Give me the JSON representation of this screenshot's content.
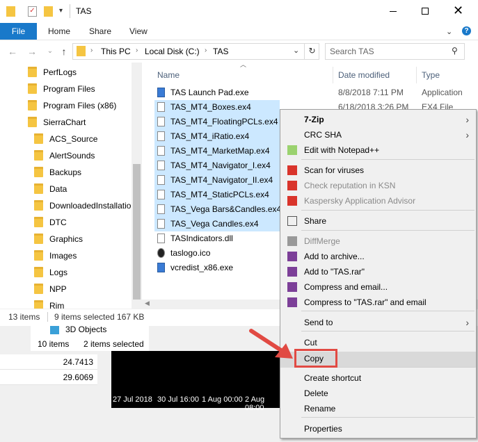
{
  "window": {
    "title": "TAS",
    "ribbon_tabs": [
      "File",
      "Home",
      "Share",
      "View"
    ]
  },
  "address": {
    "crumbs": [
      "This PC",
      "Local Disk (C:)",
      "TAS"
    ],
    "search_placeholder": "Search TAS"
  },
  "nav": {
    "items": [
      "PerfLogs",
      "Program Files",
      "Program Files (x86)",
      "SierraChart"
    ],
    "subitems": [
      "ACS_Source",
      "AlertSounds",
      "Backups",
      "Data",
      "DownloadedInstallatio",
      "DTC",
      "Graphics",
      "Images",
      "Logs",
      "NPP",
      "Rim"
    ]
  },
  "columns": {
    "name": "Name",
    "date": "Date modified",
    "type": "Type"
  },
  "files": [
    {
      "name": "TAS Launch Pad.exe",
      "date": "8/8/2018 7:11 PM",
      "type": "Application",
      "selected": false,
      "icon": "exe-icon"
    },
    {
      "name": "TAS_MT4_Boxes.ex4",
      "date": "6/18/2018 3:26 PM",
      "type": "EX4 File",
      "selected": true,
      "icon": "file-icon"
    },
    {
      "name": "TAS_MT4_FloatingPCLs.ex4",
      "date": "",
      "type": "",
      "selected": true,
      "icon": "file-icon"
    },
    {
      "name": "TAS_MT4_iRatio.ex4",
      "date": "",
      "type": "",
      "selected": true,
      "icon": "file-icon"
    },
    {
      "name": "TAS_MT4_MarketMap.ex4",
      "date": "",
      "type": "",
      "selected": true,
      "icon": "file-icon"
    },
    {
      "name": "TAS_MT4_Navigator_I.ex4",
      "date": "",
      "type": "",
      "selected": true,
      "icon": "file-icon"
    },
    {
      "name": "TAS_MT4_Navigator_II.ex4",
      "date": "",
      "type": "",
      "selected": true,
      "icon": "file-icon"
    },
    {
      "name": "TAS_MT4_StaticPCLs.ex4",
      "date": "",
      "type": "",
      "selected": true,
      "icon": "file-icon"
    },
    {
      "name": "TAS_Vega Bars&Candles.ex4",
      "date": "",
      "type": "",
      "selected": true,
      "icon": "file-icon"
    },
    {
      "name": "TAS_Vega Candles.ex4",
      "date": "",
      "type": "",
      "selected": true,
      "icon": "file-icon"
    },
    {
      "name": "TASIndicators.dll",
      "date": "",
      "type": "",
      "selected": false,
      "icon": "dll-icon"
    },
    {
      "name": "taslogo.ico",
      "date": "",
      "type": "",
      "selected": false,
      "icon": "ico-icon"
    },
    {
      "name": "vcredist_x86.exe",
      "date": "",
      "type": "",
      "selected": false,
      "icon": "exe-icon"
    }
  ],
  "status": {
    "count": "13 items",
    "selected": "9 items selected  167 KB"
  },
  "background": {
    "objects_label": "3D Objects",
    "status_count": "10 items",
    "status_selected": "2 items selected",
    "values": [
      "24.7413",
      "29.6069"
    ],
    "timeline": [
      "27 Jul 2018",
      "30 Jul 16:00",
      "1 Aug 00:00",
      "2 Aug 08:00"
    ]
  },
  "context_menu": {
    "items": [
      {
        "label": "7-Zip",
        "bold": true,
        "arrow": true
      },
      {
        "label": "CRC SHA",
        "arrow": true
      },
      {
        "label": "Edit with Notepad++",
        "icon": "notepad-icon"
      },
      {
        "label": "Scan for viruses",
        "icon": "kaspersky-icon"
      },
      {
        "label": "Check reputation in KSN",
        "disabled": true,
        "icon": "kaspersky-icon"
      },
      {
        "label": "Kaspersky Application Advisor",
        "disabled": true,
        "icon": "kaspersky-icon"
      },
      {
        "label": "Share",
        "icon": "share-icon"
      },
      {
        "label": "DiffMerge",
        "disabled": true,
        "icon": "diffmerge-icon"
      },
      {
        "label": "Add to archive...",
        "icon": "winrar-icon"
      },
      {
        "label": "Add to \"TAS.rar\"",
        "icon": "winrar-icon"
      },
      {
        "label": "Compress and email...",
        "icon": "winrar-icon"
      },
      {
        "label": "Compress to \"TAS.rar\" and email",
        "icon": "winrar-icon"
      },
      {
        "label": "Send to",
        "arrow": true
      },
      {
        "label": "Cut"
      },
      {
        "label": "Copy",
        "highlighted": true
      },
      {
        "label": "Create shortcut"
      },
      {
        "label": "Delete"
      },
      {
        "label": "Rename"
      },
      {
        "label": "Properties"
      }
    ]
  },
  "colors": {
    "accent": "#1979ca",
    "selection": "#cce8ff",
    "annotation": "#e14a43"
  }
}
